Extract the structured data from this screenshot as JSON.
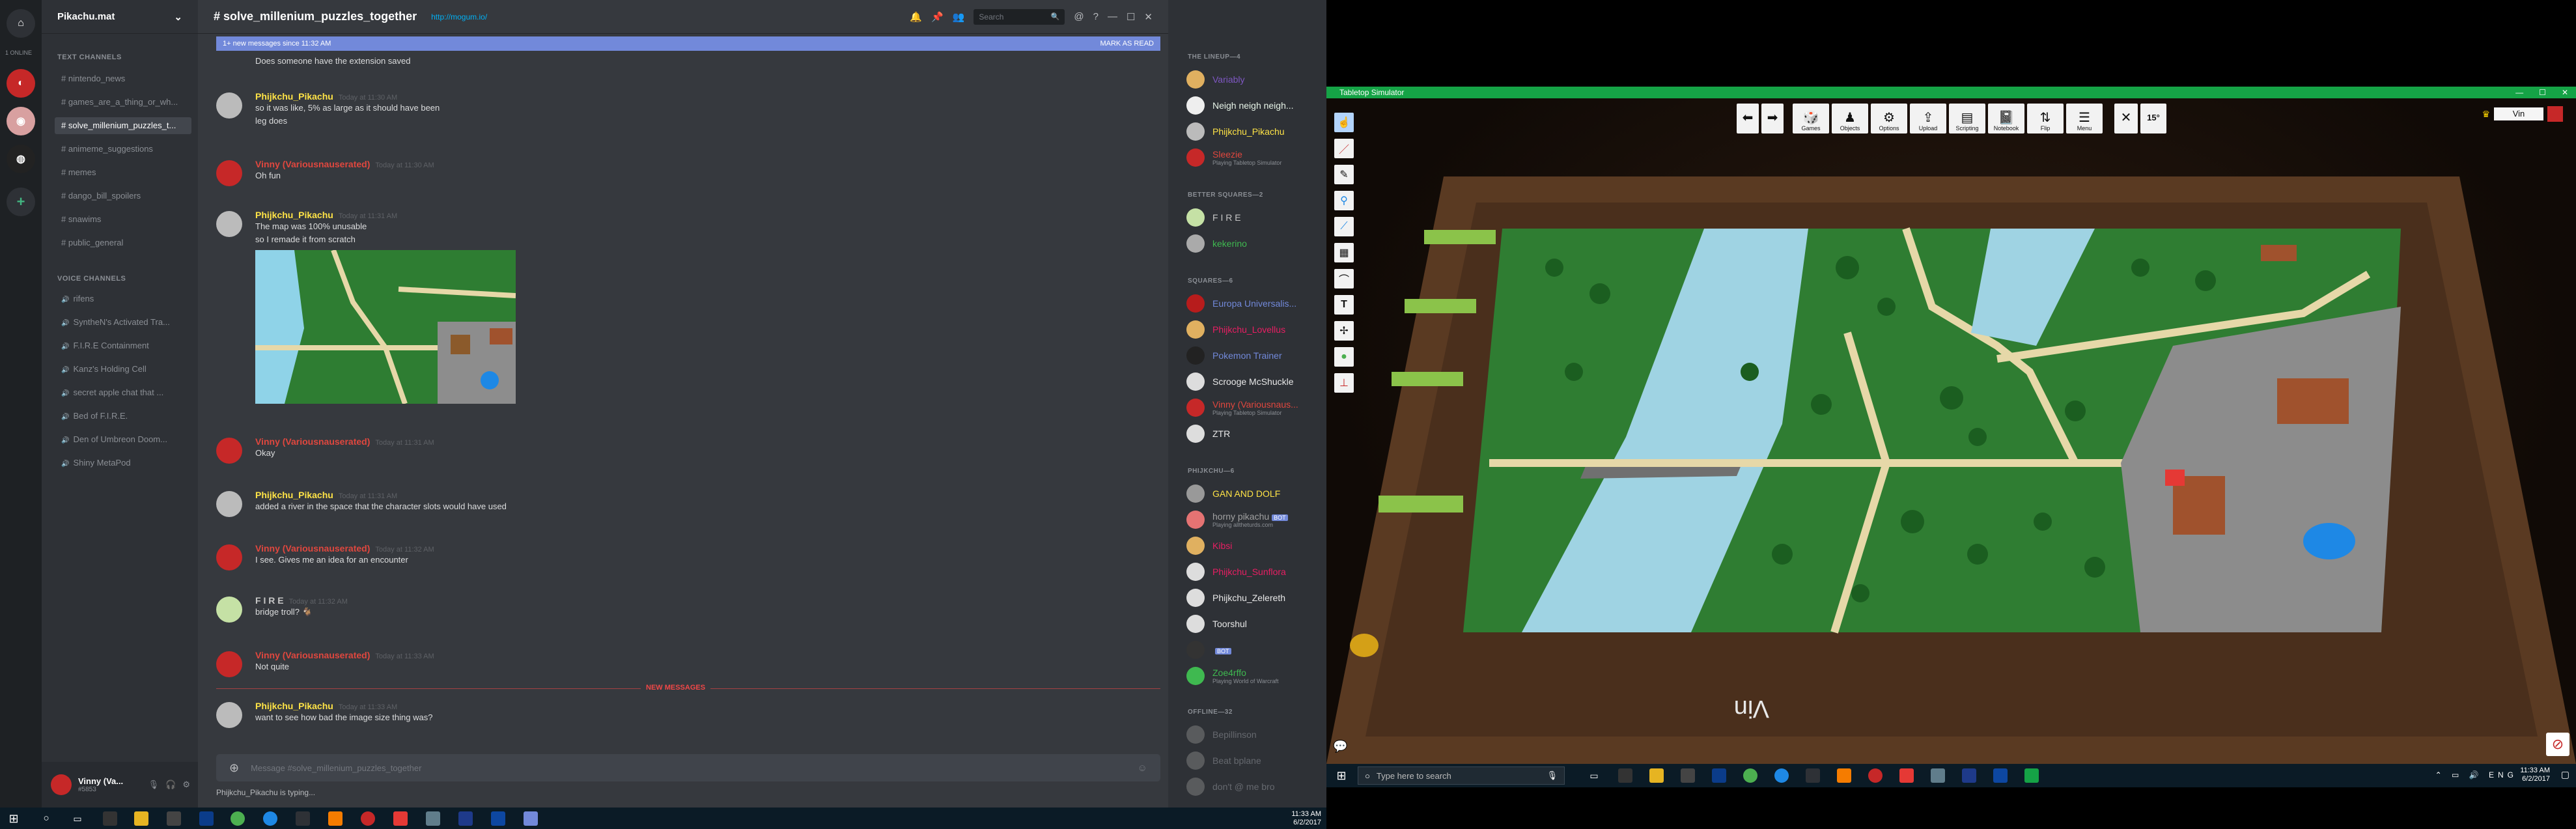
{
  "server": {
    "name": "Pikachu.mat"
  },
  "guild_label": "1 ONLINE",
  "channels": {
    "text_category": "TEXT CHANNELS",
    "text": [
      {
        "label": "# nintendo_news"
      },
      {
        "label": "# games_are_a_thing_or_wh..."
      },
      {
        "label": "# solve_millenium_puzzles_t..."
      },
      {
        "label": "# animeme_suggestions"
      },
      {
        "label": "# memes"
      },
      {
        "label": "# dango_bill_spoilers"
      },
      {
        "label": "# snawims"
      },
      {
        "label": "# public_general"
      }
    ],
    "voice_category": "VOICE CHANNELS",
    "voice": [
      {
        "label": "rifens"
      },
      {
        "label": "SyntheN's Activated Tra..."
      },
      {
        "label": "F.I.R.E Containment"
      },
      {
        "label": "Kanz's Holding Cell"
      },
      {
        "label": "secret apple chat that ..."
      },
      {
        "label": "Bed of F.I.R.E."
      },
      {
        "label": "Den of Umbreon Doom..."
      },
      {
        "label": "Shiny MetaPod"
      }
    ]
  },
  "user": {
    "name": "Vinny (Va...",
    "tag": "#5853"
  },
  "chat": {
    "channel": "# solve_millenium_puzzles_together",
    "topic": "http://mogum.io/",
    "search_placeholder": "Search",
    "new_messages_banner": "1+ new messages since 11:32 AM",
    "mark_as_read": "MARK AS READ",
    "new_messages_divider": "NEW MESSAGES",
    "input_placeholder": "Message #solve_millenium_puzzles_together",
    "typing": "Phijkchu_Pikachu is typing..."
  },
  "messages": [
    {
      "text": "Does someone have the extension saved"
    },
    {
      "name": "Phijkchu_Pikachu",
      "time": "Today at 11:30 AM",
      "color": "#ffe346",
      "lines": [
        "so it was like, 5% as large as it should have been",
        "leg does"
      ]
    },
    {
      "name": "Vinny (Variousnauserated)",
      "time": "Today at 11:30 AM",
      "color": "#e0473e",
      "lines": [
        "Oh fun"
      ]
    },
    {
      "name": "Phijkchu_Pikachu",
      "time": "Today at 11:31 AM",
      "color": "#ffe346",
      "lines": [
        "The map was 100% unusable",
        "so I remade it from scratch"
      ]
    },
    {
      "name": "Vinny (Variousnauserated)",
      "time": "Today at 11:31 AM",
      "color": "#e0473e",
      "lines": [
        "Okay"
      ]
    },
    {
      "name": "Phijkchu_Pikachu",
      "time": "Today at 11:31 AM",
      "color": "#ffe346",
      "lines": [
        "added a river in the space that the character slots would have used"
      ]
    },
    {
      "name": "Vinny (Variousnauserated)",
      "time": "Today at 11:32 AM",
      "color": "#e0473e",
      "lines": [
        "I see. Gives me an idea for an encounter"
      ]
    },
    {
      "name": "F I R E",
      "time": "Today at 11:32 AM",
      "color": "#c6c6c6",
      "lines": [
        "bridge troll?"
      ]
    },
    {
      "name": "Vinny (Variousnauserated)",
      "time": "Today at 11:33 AM",
      "color": "#e0473e",
      "lines": [
        "Not quite"
      ]
    },
    {
      "name": "Phijkchu_Pikachu",
      "time": "Today at 11:33 AM",
      "color": "#ffe346",
      "lines": [
        "want to see how bad the image size thing was?"
      ]
    }
  ],
  "members": {
    "groups": [
      {
        "title": "THE LINEUP—4",
        "items": [
          {
            "name": "Variably",
            "color": "#7e57c2"
          },
          {
            "name": "Neigh neigh neigh...",
            "color": "#e8f5e9"
          },
          {
            "name": "Phijkchu_Pikachu",
            "color": "#ffe346"
          },
          {
            "name": "Sleezie",
            "color": "#e0473e",
            "game": "Playing Tabletop Simulator"
          }
        ]
      },
      {
        "title": "BETTER SQUARES—2",
        "items": [
          {
            "name": "F I R E",
            "color": "#c6c6c6"
          },
          {
            "name": "kekerino",
            "color": "#3fb950"
          }
        ]
      },
      {
        "title": "SQUARES—6",
        "items": [
          {
            "name": "Europa Universalis...",
            "color": "#7289da"
          },
          {
            "name": "Phijkchu_Lovellus",
            "color": "#e91e63"
          },
          {
            "name": "Pokemon Trainer",
            "color": "#7289da"
          },
          {
            "name": "Scrooge McShuckle",
            "color": "#e8e8e8"
          },
          {
            "name": "Vinny (Variousnaus...",
            "color": "#e0473e",
            "game": "Playing Tabletop Simulator"
          },
          {
            "name": "ZTR",
            "color": "#e8e8e8"
          }
        ]
      },
      {
        "title": "PHIJKCHU—6",
        "items": [
          {
            "name": "GAN AND DOLF",
            "color": "#ffe346"
          },
          {
            "name": "horny pikachu",
            "color": "#a1a1a1",
            "game": "Playing alltheturds.com",
            "bot": "BOT"
          },
          {
            "name": "Kibsi",
            "color": "#e91e63"
          },
          {
            "name": "Phijkchu_Sunflora",
            "color": "#e91e63"
          },
          {
            "name": "Phijkchu_Zelereth",
            "color": "#e8e8e8"
          },
          {
            "name": "Toorshul",
            "color": "#e8e8e8"
          },
          {
            "name": "",
            "color": "#e8e8e8",
            "bot": "BOT"
          },
          {
            "name": "Zoe4rffo",
            "color": "#3fb950",
            "game": "Playing World of Warcraft"
          }
        ]
      },
      {
        "title": "OFFLINE—32",
        "items": [
          {
            "name": "Bepillinson",
            "color": "#6b6e73"
          },
          {
            "name": "Beat bplane",
            "color": "#6b6e73"
          },
          {
            "name": "don't @ me bro",
            "color": "#6b6e73"
          }
        ]
      }
    ]
  },
  "taskbar_left": {
    "time": "11:33 AM",
    "date": "6/2/2017"
  },
  "tts": {
    "title": "Tabletop Simulator",
    "toolbar": [
      "Games",
      "Objects",
      "Options",
      "Upload",
      "Scripting",
      "Notebook",
      "Flip",
      "Menu"
    ],
    "zoom": "15°",
    "player": "Vin",
    "table_text": "Vin"
  },
  "taskbar_right": {
    "search": "Type here to search",
    "time": "11:33 AM",
    "date": "6/2/2017"
  },
  "colors": {
    "accent": "#7289da",
    "tts_green": "#15a346"
  }
}
